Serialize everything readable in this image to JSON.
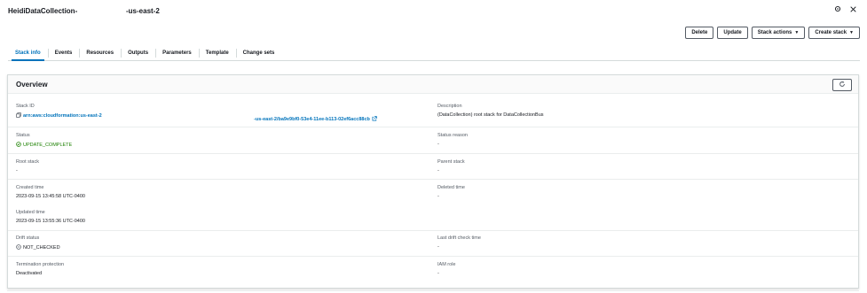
{
  "header": {
    "stack_name": "HeidiDataCollection-",
    "region": "-us-east-2"
  },
  "actions": {
    "delete": "Delete",
    "update": "Update",
    "stack_actions": "Stack actions",
    "create_stack": "Create stack"
  },
  "tabs": [
    "Stack info",
    "Events",
    "Resources",
    "Outputs",
    "Parameters",
    "Template",
    "Change sets"
  ],
  "overview": {
    "title": "Overview",
    "stack_id_label": "Stack ID",
    "stack_id_prefix": "arn:aws:cloudformation:us-east-2",
    "stack_id_suffix": "-us-east-2/ba9e9bf0-53e4-11ee-b113-02ef6acc88cb",
    "description_label": "Description",
    "description_value": "(DataCollection) root stack for DataCollectionBus",
    "status_label": "Status",
    "status_value": "UPDATE_COMPLETE",
    "status_reason_label": "Status reason",
    "status_reason_value": "-",
    "root_stack_label": "Root stack",
    "root_stack_value": "-",
    "parent_stack_label": "Parent stack",
    "parent_stack_value": "-",
    "created_time_label": "Created time",
    "created_time_value": "2023-09-15 13:45:58 UTC-0400",
    "deleted_time_label": "Deleted time",
    "deleted_time_value": "-",
    "updated_time_label": "Updated time",
    "updated_time_value": "2023-09-15 13:55:36 UTC-0400",
    "drift_status_label": "Drift status",
    "drift_status_value": "NOT_CHECKED",
    "last_drift_label": "Last drift check time",
    "last_drift_value": "-",
    "termination_label": "Termination protection",
    "termination_value": "Deactivated",
    "iam_role_label": "IAM role",
    "iam_role_value": "-"
  },
  "colors": {
    "link": "#0073bb",
    "success": "#1d8102",
    "text": "#16191f",
    "label": "#545b64"
  },
  "icons": [
    "settings-icon",
    "close-icon",
    "refresh-icon",
    "copy-icon",
    "external-link-icon",
    "success-icon",
    "not-checked-icon",
    "caret-down-icon"
  ]
}
